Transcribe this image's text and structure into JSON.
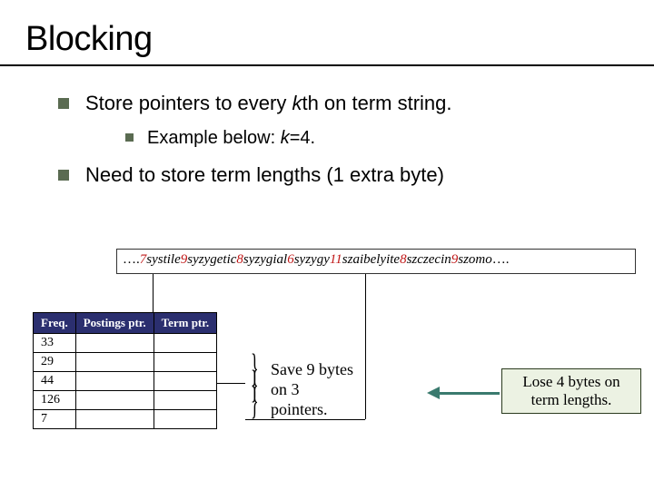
{
  "title": "Blocking",
  "bullets": {
    "b1_pre": "Store pointers to every ",
    "b1_k": "k",
    "b1_post": "th on term string.",
    "sub_pre": "Example below: ",
    "sub_k": "k",
    "sub_post": "=4.",
    "b2": "Need to store term lengths (1 extra byte)"
  },
  "termstring": {
    "lead": "….",
    "segments": [
      {
        "n": "7",
        "w": "systile"
      },
      {
        "n": "9",
        "w": "syzygetic"
      },
      {
        "n": "8",
        "w": "syzygial"
      },
      {
        "n": "6",
        "w": "syzygy"
      },
      {
        "n": "11",
        "w": "szaibelyite"
      },
      {
        "n": "8",
        "w": "szczecin"
      },
      {
        "n": "9",
        "w": "szomo"
      }
    ],
    "trail": "…."
  },
  "table": {
    "headers": [
      "Freq.",
      "Postings ptr.",
      "Term ptr."
    ],
    "freqs": [
      "33",
      "29",
      "44",
      "126",
      "7"
    ]
  },
  "save_text_l1": "Save 9 bytes",
  "save_text_l2": "on 3",
  "save_text_l3": "pointers.",
  "lose_text_l1": "Lose 4 bytes on",
  "lose_text_l2": "term lengths."
}
